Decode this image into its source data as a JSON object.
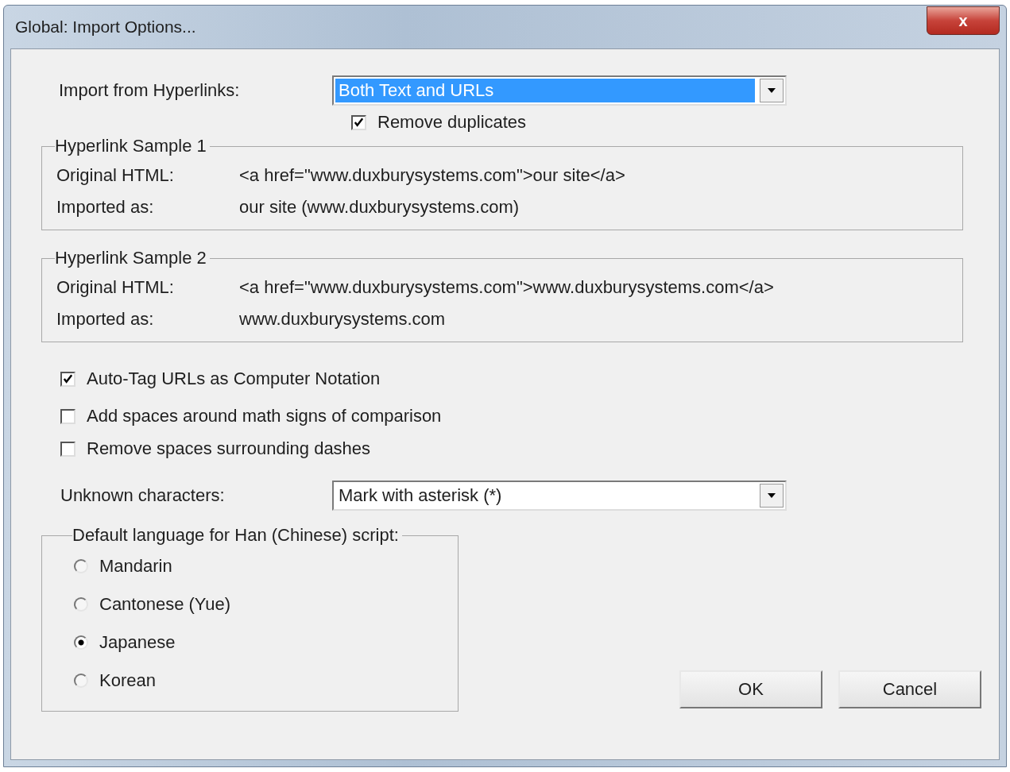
{
  "window": {
    "title": "Global: Import Options...",
    "close": "x"
  },
  "import_from_hyperlinks": {
    "label": "Import from Hyperlinks:",
    "value": "Both Text and URLs",
    "highlighted": true
  },
  "remove_duplicates": {
    "label": "Remove duplicates",
    "checked": true
  },
  "samples": [
    {
      "title": "Hyperlink Sample 1",
      "rows": [
        {
          "label": "Original HTML:",
          "value": "<a href=\"www.duxburysystems.com\">our site</a>"
        },
        {
          "label": "Imported as:",
          "value": "our site (www.duxburysystems.com)"
        }
      ]
    },
    {
      "title": "Hyperlink Sample 2",
      "rows": [
        {
          "label": "Original HTML:",
          "value": "<a href=\"www.duxburysystems.com\">www.duxburysystems.com</a>"
        },
        {
          "label": "Imported as:",
          "value": "www.duxburysystems.com"
        }
      ]
    }
  ],
  "options": [
    {
      "label": "Auto-Tag URLs as Computer Notation",
      "checked": true
    },
    {
      "label": "Add spaces around math signs of comparison",
      "checked": false
    },
    {
      "label": "Remove spaces surrounding dashes",
      "checked": false
    }
  ],
  "unknown_characters": {
    "label": "Unknown characters:",
    "value": "Mark with asterisk (*)",
    "highlighted": false
  },
  "han_language": {
    "title": "Default language for Han (Chinese) script:",
    "choices": [
      {
        "label": "Mandarin",
        "selected": false
      },
      {
        "label": "Cantonese (Yue)",
        "selected": false
      },
      {
        "label": "Japanese",
        "selected": true
      },
      {
        "label": "Korean",
        "selected": false
      }
    ]
  },
  "buttons": [
    "OK",
    "Cancel"
  ]
}
